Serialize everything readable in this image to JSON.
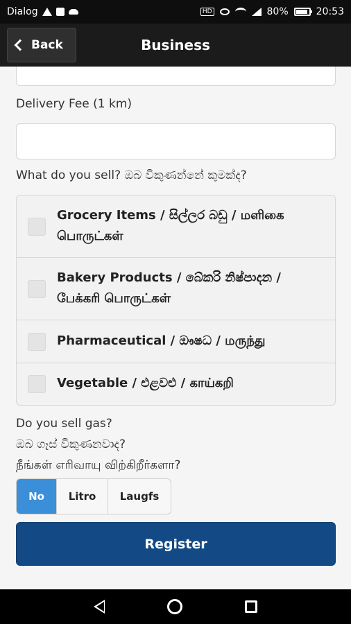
{
  "statusbar": {
    "carrier": "Dialog",
    "battery": "80%",
    "time": "20:53",
    "hd_badge": "HD"
  },
  "header": {
    "back_label": "Back",
    "title": "Business"
  },
  "form": {
    "delivery_fee_label": "Delivery Fee (1 km)",
    "delivery_fee_value": "",
    "what_sell_label": "What do you sell? ඔබ විකුණන්නේ කුමක්ද?",
    "items": [
      {
        "label": "Grocery Items / සිල්ලර බඩු / மளிகை பொருட்கள்",
        "checked": false
      },
      {
        "label": "Bakery Products / බේකරි නිෂ්පාදන / பேக்கரி பொருட்கள்",
        "checked": false
      },
      {
        "label": "Pharmaceutical / ඖෂධ / மருந்து",
        "checked": false
      },
      {
        "label": "Vegetable / එළවළු / காய்கறி",
        "checked": false
      }
    ],
    "gas_question_lines": [
      "Do you sell gas?",
      "ඔබ ගෑස් විකුණනවාද?",
      "நீங்கள் எரிவாயு விற்கிறீர்களா?"
    ],
    "gas_options": [
      "No",
      "Litro",
      "Laugfs"
    ],
    "gas_selected": "No",
    "register_label": "Register"
  },
  "colors": {
    "accent": "#3a8fd8",
    "register": "#134a86",
    "header": "#1b1b1b"
  },
  "icons": {
    "back": "chevron-left-icon",
    "nav_back": "nav-back-icon",
    "nav_home": "nav-home-icon",
    "nav_recent": "nav-recent-icon"
  }
}
